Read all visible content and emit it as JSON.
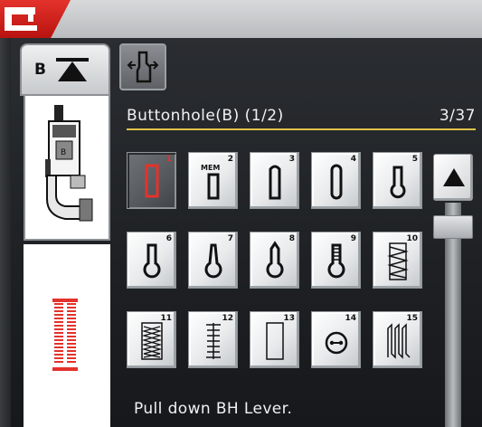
{
  "header": {
    "title": "Buttonhole(B) (1/2)",
    "count": "3/37"
  },
  "foot_tab": {
    "letter": "B"
  },
  "stitches": [
    {
      "num": "1",
      "icon": "bartack-rect-buttonhole-icon",
      "selected": true
    },
    {
      "num": "2",
      "icon": "memory-buttonhole-icon",
      "mem": "MEM"
    },
    {
      "num": "3",
      "icon": "rounded-buttonhole-icon"
    },
    {
      "num": "4",
      "icon": "round-both-ends-buttonhole-icon"
    },
    {
      "num": "5",
      "icon": "keyhole-buttonhole-icon"
    },
    {
      "num": "6",
      "icon": "keyhole-wide-buttonhole-icon"
    },
    {
      "num": "7",
      "icon": "keyhole-tapered-buttonhole-icon"
    },
    {
      "num": "8",
      "icon": "keyhole-pointed-buttonhole-icon"
    },
    {
      "num": "9",
      "icon": "keyhole-bartack-buttonhole-icon"
    },
    {
      "num": "10",
      "icon": "stretch-buttonhole-icon"
    },
    {
      "num": "11",
      "icon": "heirloom-buttonhole-icon"
    },
    {
      "num": "12",
      "icon": "ladder-buttonhole-icon"
    },
    {
      "num": "13",
      "icon": "bound-buttonhole-icon"
    },
    {
      "num": "14",
      "icon": "button-sewing-icon"
    },
    {
      "num": "15",
      "icon": "darning-icon"
    }
  ],
  "message": "Pull down BH Lever.",
  "colors": {
    "accent": "#e4322c",
    "header_line": "#e0c34a"
  }
}
